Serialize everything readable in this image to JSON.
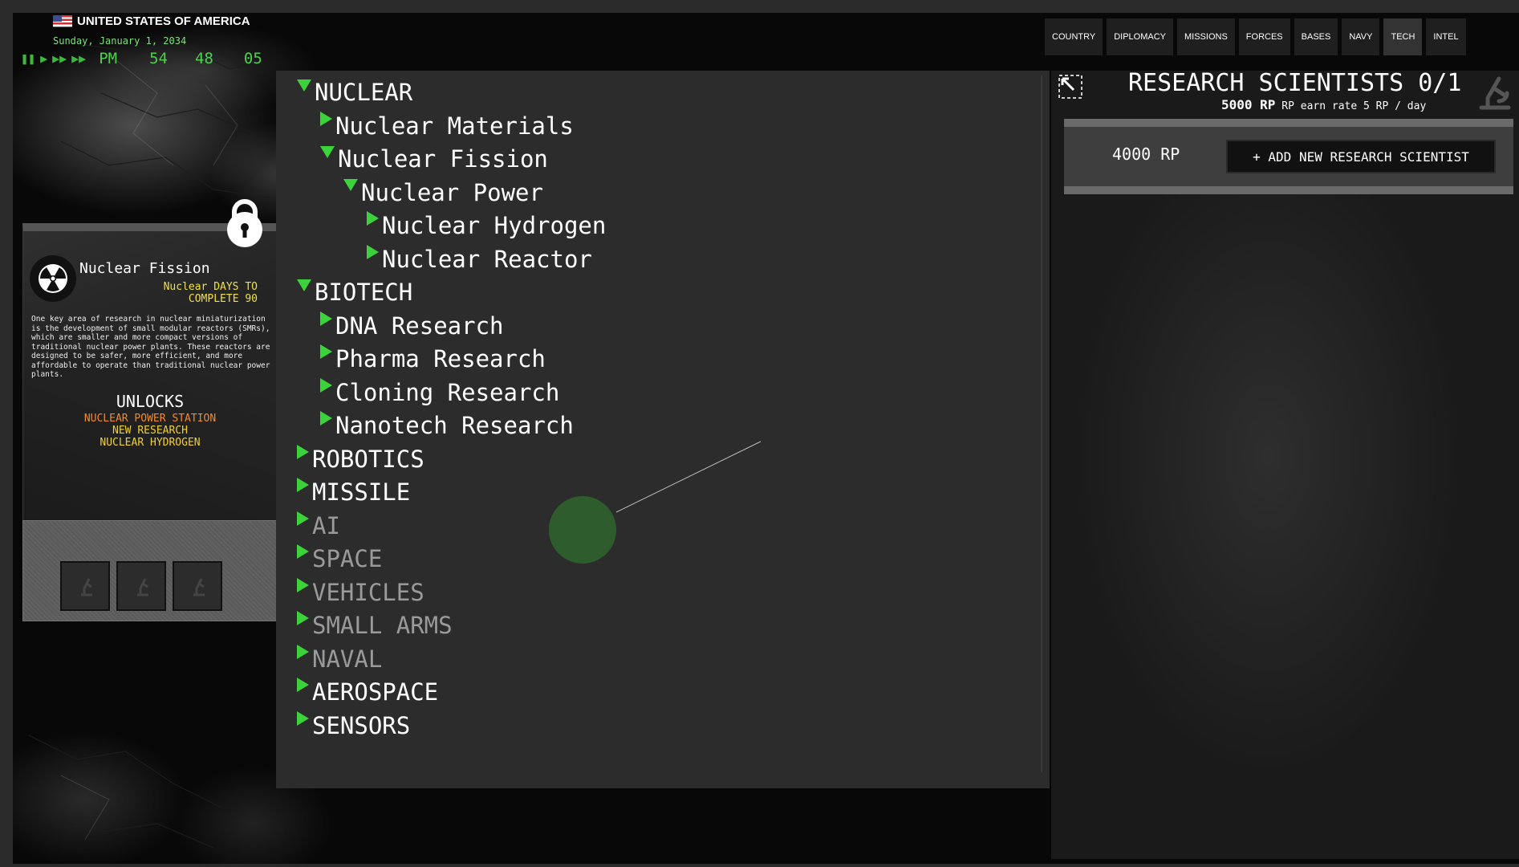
{
  "header": {
    "country": "UNITED STATES OF AMERICA",
    "date": "Sunday, January 1, 2034",
    "clock": {
      "ampm": "PM",
      "hours": "54",
      "minutes": "48",
      "seconds": "05"
    }
  },
  "tabs": [
    {
      "label": "COUNTRY"
    },
    {
      "label": "DIPLOMACY"
    },
    {
      "label": "MISSIONS"
    },
    {
      "label": "FORCES"
    },
    {
      "label": "BASES"
    },
    {
      "label": "NAVY"
    },
    {
      "label": "TECH"
    },
    {
      "label": "INTEL"
    }
  ],
  "active_tab": "TECH",
  "detail_card": {
    "title": "Nuclear Fission",
    "days_line1": "Nuclear DAYS TO",
    "days_line2": "COMPLETE 90",
    "description": "One key area of research in nuclear miniaturization is the development of small modular reactors (SMRs), which are smaller and more compact versions of traditional nuclear power plants. These reactors are designed to be safer, more efficient, and more affordable to operate than traditional nuclear power plants.",
    "unlocks_heading": "UNLOCKS",
    "unlocks": [
      "NUCLEAR POWER STATION",
      "NEW RESEARCH",
      "NUCLEAR HYDROGEN"
    ]
  },
  "tech_tree": [
    {
      "label": "NUCLEAR",
      "depth": 0,
      "expanded": true,
      "dim": false
    },
    {
      "label": "Nuclear Materials",
      "depth": 1,
      "expanded": false,
      "dim": false
    },
    {
      "label": "Nuclear Fission",
      "depth": 1,
      "expanded": true,
      "dim": false
    },
    {
      "label": "Nuclear Power",
      "depth": 2,
      "expanded": true,
      "dim": false
    },
    {
      "label": "Nuclear Hydrogen",
      "depth": 3,
      "expanded": false,
      "dim": false
    },
    {
      "label": "Nuclear Reactor",
      "depth": 3,
      "expanded": false,
      "dim": false
    },
    {
      "label": "BIOTECH",
      "depth": 0,
      "expanded": true,
      "dim": false
    },
    {
      "label": "DNA Research",
      "depth": 1,
      "expanded": false,
      "dim": false
    },
    {
      "label": "Pharma Research",
      "depth": 1,
      "expanded": false,
      "dim": false
    },
    {
      "label": "Cloning Research",
      "depth": 1,
      "expanded": false,
      "dim": false
    },
    {
      "label": "Nanotech Research",
      "depth": 1,
      "expanded": false,
      "dim": false
    },
    {
      "label": "ROBOTICS",
      "depth": 0,
      "expanded": false,
      "dim": false
    },
    {
      "label": "MISSILE",
      "depth": 0,
      "expanded": false,
      "dim": false
    },
    {
      "label": "AI",
      "depth": 0,
      "expanded": false,
      "dim": true
    },
    {
      "label": "SPACE",
      "depth": 0,
      "expanded": false,
      "dim": true
    },
    {
      "label": "VEHICLES",
      "depth": 0,
      "expanded": false,
      "dim": true
    },
    {
      "label": "SMALL ARMS",
      "depth": 0,
      "expanded": false,
      "dim": true
    },
    {
      "label": "NAVAL",
      "depth": 0,
      "expanded": false,
      "dim": true
    },
    {
      "label": "AEROSPACE",
      "depth": 0,
      "expanded": false,
      "dim": false
    },
    {
      "label": "SENSORS",
      "depth": 0,
      "expanded": false,
      "dim": false
    }
  ],
  "research": {
    "title": "RESEARCH SCIENTISTS 0/1",
    "rp_total": "5000 RP",
    "rate_text": "RP earn rate 5 RP / day",
    "rp_cost": "4000 RP",
    "add_button": "+ ADD NEW RESEARCH SCIENTIST"
  },
  "colors": {
    "accent_green": "#3bd23b",
    "unlock_orange": "#f08a2a",
    "unlock_yellow": "#f0d030",
    "dim_text": "#9a9a9a"
  }
}
